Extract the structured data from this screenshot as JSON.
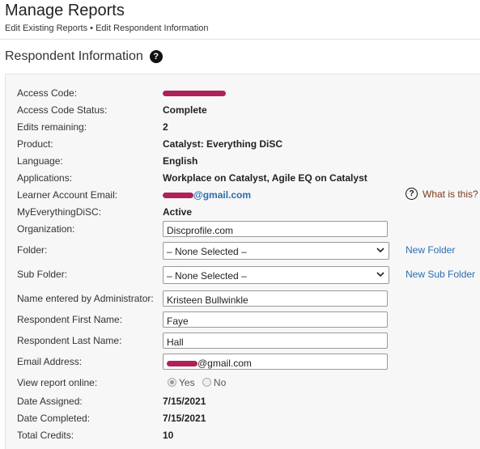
{
  "header": {
    "title": "Manage Reports",
    "breadcrumb": "Edit Existing Reports • Edit Respondent Information"
  },
  "section": {
    "title": "Respondent Information",
    "help_icon": "question-circle-icon"
  },
  "info": {
    "access_code_label": "Access Code:",
    "status_label": "Access Code Status:",
    "status_value": "Complete",
    "edits_label": "Edits remaining:",
    "edits_value": "2",
    "product_label": "Product:",
    "product_value": "Catalyst: Everything DiSC",
    "language_label": "Language:",
    "language_value": "English",
    "applications_label": "Applications:",
    "applications_value": "Workplace on Catalyst, Agile EQ on Catalyst",
    "learner_email_label": "Learner Account Email:",
    "learner_email_suffix": "@gmail.com",
    "what_is_this": "What is this?",
    "myed_label": "MyEverythingDiSC:",
    "myed_value": "Active"
  },
  "form": {
    "organization_label": "Organization:",
    "organization_value": "Discprofile.com",
    "folder_label": "Folder:",
    "folder_selected": "– None Selected –",
    "new_folder": "New Folder",
    "subfolder_label": "Sub Folder:",
    "subfolder_selected": "– None Selected –",
    "new_subfolder": "New Sub Folder",
    "admin_name_label": "Name entered by Administrator:",
    "admin_name_value": "Kristeen Bullwinkle",
    "first_name_label": "Respondent First Name:",
    "first_name_value": "Faye",
    "last_name_label": "Respondent Last Name:",
    "last_name_value": "Hall",
    "email_label": "Email Address:",
    "email_suffix": "@gmail.com",
    "view_online_label": "View report online:",
    "yes_label": "Yes",
    "no_label": "No",
    "view_online_selected": "Yes"
  },
  "dates": {
    "assigned_label": "Date Assigned:",
    "assigned_value": "7/15/2021",
    "completed_label": "Date Completed:",
    "completed_value": "7/15/2021",
    "credits_label": "Total Credits:",
    "credits_value": "10"
  },
  "colors": {
    "link": "#2a6db0",
    "redaction": "#b0205a",
    "panel_bg": "#f7f7f7"
  }
}
